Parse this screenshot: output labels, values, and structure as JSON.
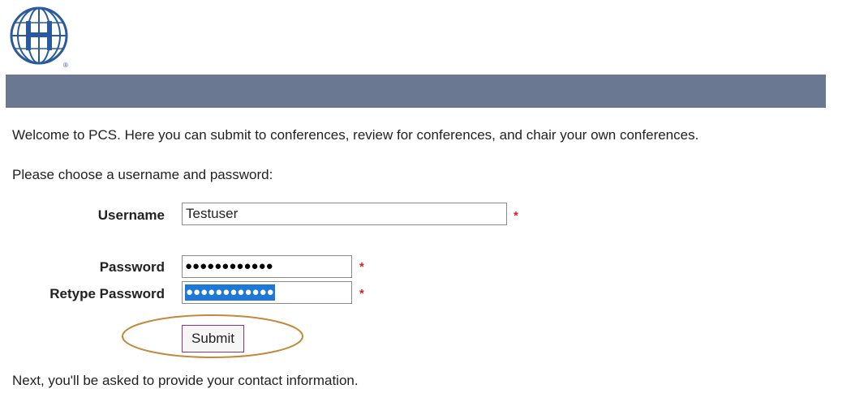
{
  "header": {
    "logo_icon": "globe-logo-icon",
    "logo_mark": "®",
    "banner_color": "#6b7891"
  },
  "main": {
    "welcome_text": "Welcome to PCS. Here you can submit to conferences, review for conferences, and chair your own conferences.",
    "choose_text": "Please choose a username and password:",
    "next_text": "Next, you'll be asked to provide your contact information."
  },
  "form": {
    "username_label": "Username",
    "username_value": "Testuser",
    "password_label": "Password",
    "password_mask": "●●●●●●●●●●●●",
    "retype_label": "Retype Password",
    "retype_mask": "●●●●●●●●●●●●",
    "required_marker": "*",
    "submit_label": "Submit"
  },
  "annotation": {
    "highlight_color": "#c08a3a"
  }
}
